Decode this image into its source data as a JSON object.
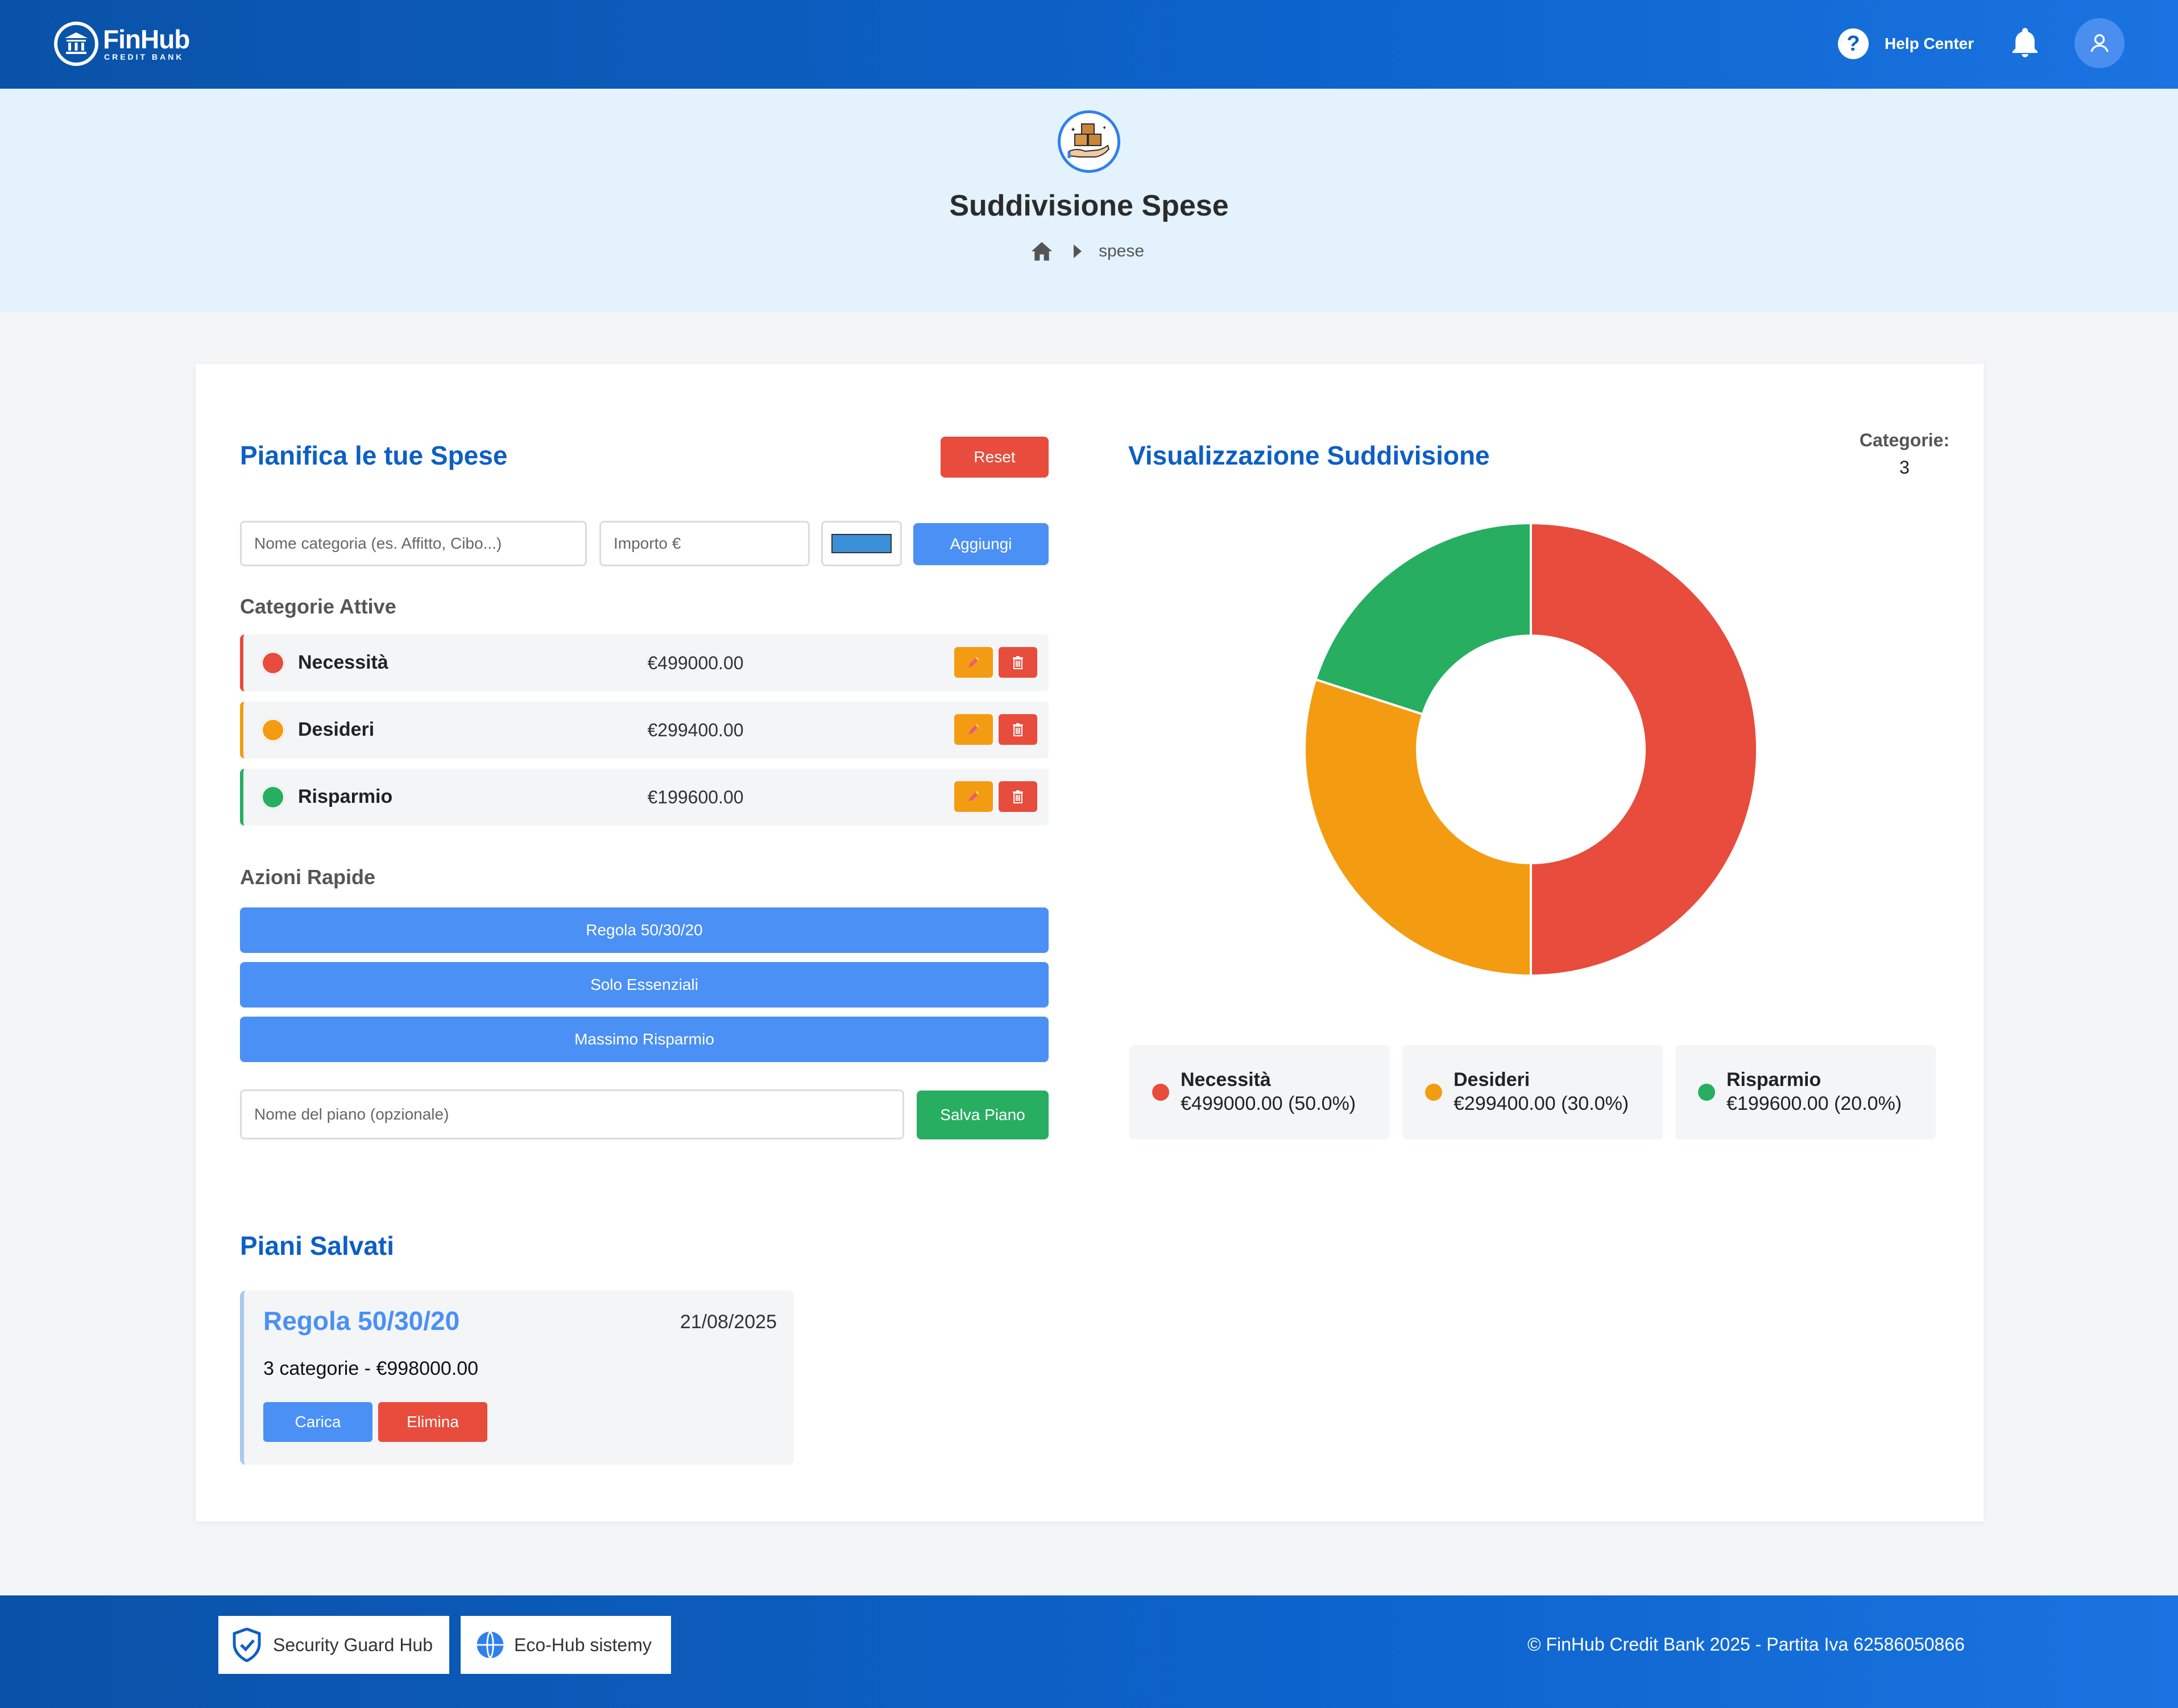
{
  "brand": {
    "name": "FinHub",
    "tagline": "CREDIT BANK"
  },
  "header": {
    "help_label": "Help Center"
  },
  "hero": {
    "title": "Suddivisione Spese",
    "breadcrumb_current": "spese"
  },
  "planner": {
    "title": "Pianifica le tue Spese",
    "reset_label": "Reset",
    "name_placeholder": "Nome categoria (es. Affitto, Cibo...)",
    "amount_placeholder": "Importo €",
    "color_value": "#3b8fd6",
    "add_label": "Aggiungi",
    "active_title": "Categorie Attive",
    "categories": [
      {
        "name": "Necessità",
        "amount": "€499000.00",
        "color": "#e74c3c"
      },
      {
        "name": "Desideri",
        "amount": "€299400.00",
        "color": "#f39c12"
      },
      {
        "name": "Risparmio",
        "amount": "€199600.00",
        "color": "#27ae60"
      }
    ],
    "quick_title": "Azioni Rapide",
    "quick_actions": [
      "Regola 50/30/20",
      "Solo Essenziali",
      "Massimo Risparmio"
    ],
    "plan_name_placeholder": "Nome del piano (opzionale)",
    "save_label": "Salva Piano"
  },
  "visualization": {
    "title": "Visualizzazione Suddivisione",
    "count_label": "Categorie:",
    "count_value": "3",
    "legend": [
      {
        "name": "Necessità",
        "value": "€499000.00 (50.0%)",
        "color": "#e74c3c"
      },
      {
        "name": "Desideri",
        "value": "€299400.00 (30.0%)",
        "color": "#f39c12"
      },
      {
        "name": "Risparmio",
        "value": "€199600.00 (20.0%)",
        "color": "#27ae60"
      }
    ]
  },
  "chart_data": {
    "type": "pie",
    "categories": [
      "Necessità",
      "Desideri",
      "Risparmio"
    ],
    "values": [
      499000,
      299400,
      199600
    ],
    "colors": [
      "#e74c3c",
      "#f39c12",
      "#27ae60"
    ],
    "donut": true
  },
  "saved": {
    "title": "Piani Salvati",
    "plans": [
      {
        "name": "Regola 50/30/20",
        "date": "21/08/2025",
        "summary": "3 categorie - €998000.00",
        "load_label": "Carica",
        "delete_label": "Elimina"
      }
    ]
  },
  "footer": {
    "badges": [
      "Security Guard Hub",
      "Eco-Hub sistemy"
    ],
    "copyright": "© FinHub Credit Bank 2025 - Partita Iva 62586050866"
  }
}
